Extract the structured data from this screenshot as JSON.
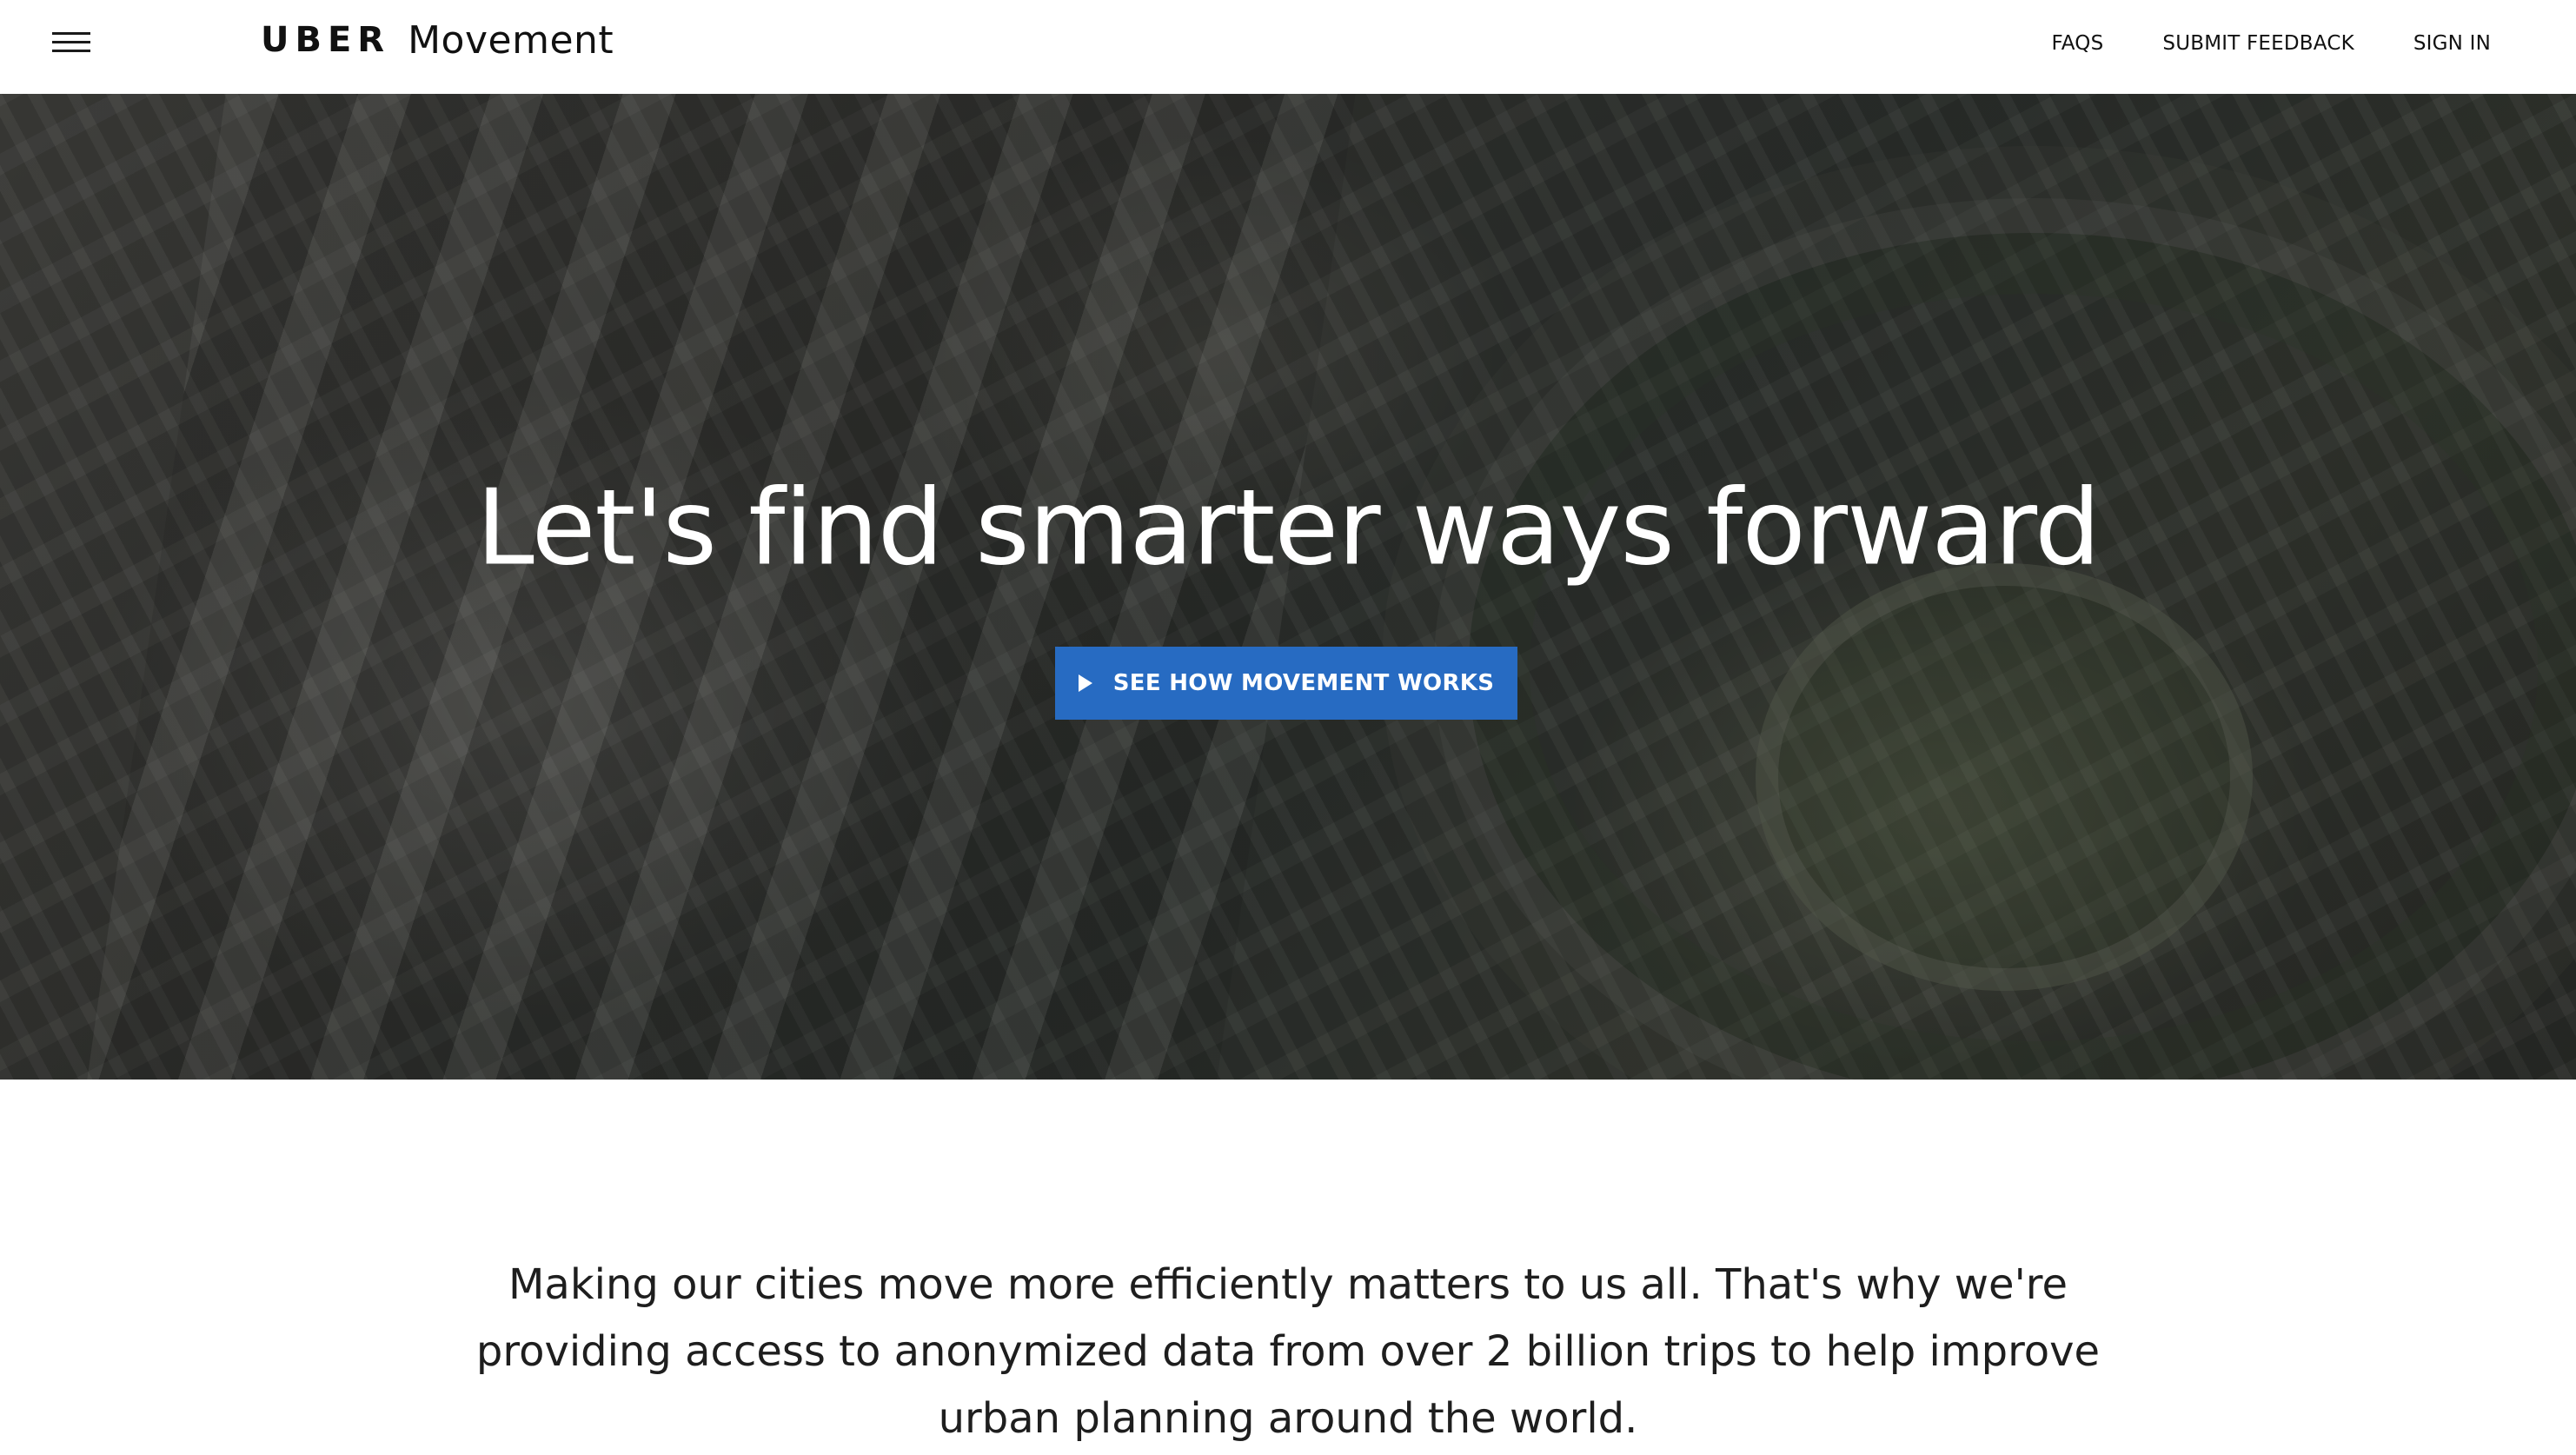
{
  "header": {
    "brand_primary": "UBER",
    "brand_secondary": "Movement",
    "nav": [
      {
        "label": "FAQS"
      },
      {
        "label": "SUBMIT FEEDBACK"
      },
      {
        "label": "SIGN IN"
      }
    ]
  },
  "hero": {
    "title": "Let's find smarter ways forward",
    "cta_label": "SEE HOW MOVEMENT WORKS"
  },
  "intro": {
    "text": "Making our cities move more efficiently matters to us all. That's why we're providing access to anonymized data from over 2 billion trips to help improve urban planning around the world."
  },
  "colors": {
    "cta_background": "#276bc2",
    "header_background": "#ffffff",
    "text": "#1a1a1a"
  },
  "icons": {
    "menu": "hamburger-menu-icon",
    "cta": "play-icon"
  }
}
